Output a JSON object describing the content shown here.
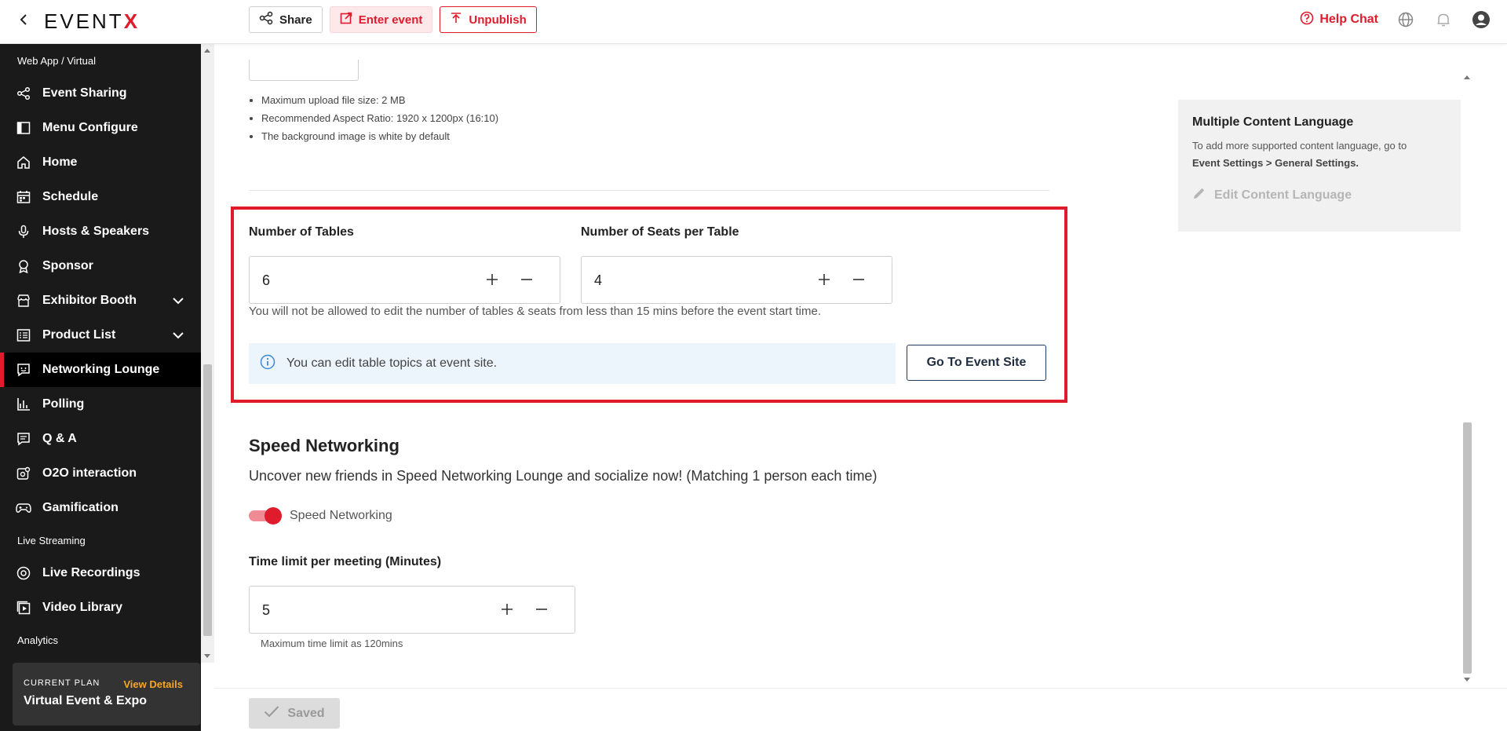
{
  "header": {
    "logo_main": "EVENT",
    "logo_accent": "X",
    "share_label": "Share",
    "enter_label": "Enter event",
    "unpublish_label": "Unpublish",
    "help_label": "Help Chat"
  },
  "sidebar": {
    "section_webapp": "Web App / Virtual",
    "items": [
      {
        "label": "Event Sharing",
        "icon": "share-icon"
      },
      {
        "label": "Menu Configure",
        "icon": "layout-icon"
      },
      {
        "label": "Home",
        "icon": "home-icon"
      },
      {
        "label": "Schedule",
        "icon": "calendar-icon"
      },
      {
        "label": "Hosts & Speakers",
        "icon": "microphone-icon"
      },
      {
        "label": "Sponsor",
        "icon": "badge-icon"
      },
      {
        "label": "Exhibitor Booth",
        "icon": "store-icon"
      },
      {
        "label": "Product List",
        "icon": "list-icon"
      },
      {
        "label": "Networking Lounge",
        "icon": "chat-icon"
      },
      {
        "label": "Polling",
        "icon": "bar-chart-icon"
      },
      {
        "label": "Q & A",
        "icon": "comment-icon"
      },
      {
        "label": "O2O interaction",
        "icon": "interaction-icon"
      },
      {
        "label": "Gamification",
        "icon": "gamepad-icon"
      }
    ],
    "section_live": "Live Streaming",
    "live_items": [
      {
        "label": "Live Recordings",
        "icon": "record-icon"
      },
      {
        "label": "Video Library",
        "icon": "video-library-icon"
      }
    ],
    "section_analytics": "Analytics",
    "plan": {
      "label": "CURRENT PLAN",
      "view_details": "View Details",
      "name": "Virtual Event & Expo"
    }
  },
  "upload": {
    "bullets": [
      "Maximum upload file size: 2 MB",
      "Recommended Aspect Ratio: 1920 x 1200px (16:10)",
      "The background image is white by default"
    ]
  },
  "tables": {
    "tables_label": "Number of Tables",
    "tables_value": "6",
    "seats_label": "Number of Seats per Table",
    "seats_value": "4",
    "note": "You will not be allowed to edit the number of tables & seats from less than 15 mins before the event start time.",
    "info": "You can edit table topics at event site.",
    "go_button": "Go To Event Site"
  },
  "speed": {
    "title": "Speed Networking",
    "description": "Uncover new friends in Speed Networking Lounge and socialize now! (Matching 1 person each time)",
    "toggle_label": "Speed Networking",
    "toggle_on": true,
    "time_label": "Time limit per meeting (Minutes)",
    "time_value": "5",
    "time_hint": "Maximum time limit as 120mins"
  },
  "footer": {
    "saved_label": "Saved"
  },
  "language_panel": {
    "title": "Multiple Content Language",
    "desc": "To add more supported content language, go to",
    "path": "Event Settings > General Settings.",
    "edit_label": "Edit Content Language"
  },
  "colors": {
    "brand_red": "#e01b2c",
    "sidebar_bg": "#1a1a1a",
    "plan_accent": "#f5a623"
  }
}
